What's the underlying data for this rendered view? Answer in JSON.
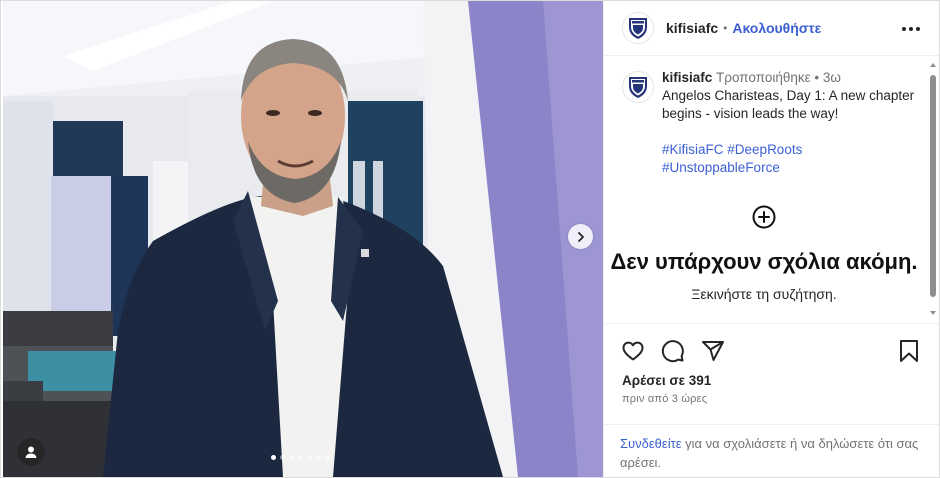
{
  "post": {
    "username": "kifisiafc",
    "separator": "•",
    "follow_label": "Ακολουθήστε",
    "more_icon": "more-horizontal-icon"
  },
  "caption": {
    "username": "kifisiafc",
    "edited_label": "Τροποποιήθηκε",
    "dot": "•",
    "age": "3ω",
    "text": "Angelos Charisteas, Day 1: A new chapter begins - vision leads the way!",
    "hashtags": [
      "#KifisiaFC",
      "#DeepRoots",
      "#UnstoppableForce"
    ]
  },
  "comments": {
    "empty_icon": "add-circle-icon",
    "empty_title": "Δεν υπάρχουν σχόλια ακόμη.",
    "empty_subtitle": "Ξεκινήστε τη συζήτηση."
  },
  "actions": {
    "icons": [
      "heart-icon",
      "comment-icon",
      "share-icon",
      "bookmark-icon"
    ],
    "likes_label": "Αρέσει σε 391",
    "time_label": "πριν από 3 ώρες"
  },
  "login_prompt": {
    "link_text": "Συνδεθείτε",
    "rest_text": " για να σχολιάσετε ή να δηλώσετε ότι σας αρέσει."
  },
  "carousel": {
    "slide_count": 7,
    "active_index": 0
  },
  "colors": {
    "link": "#3b5fd3",
    "wall_purple": "#8c84c9"
  }
}
